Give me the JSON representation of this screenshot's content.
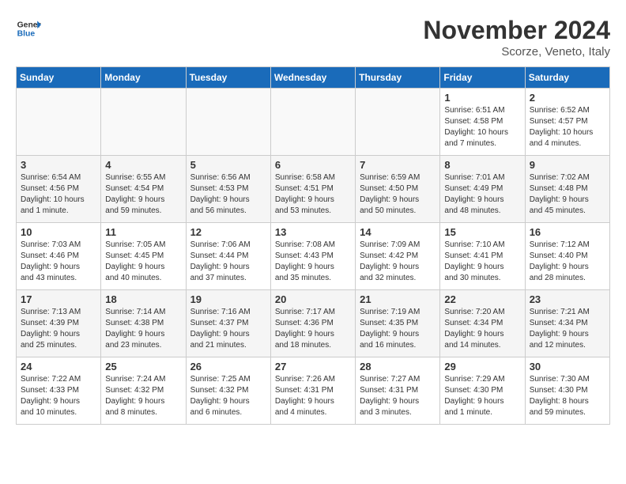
{
  "logo": {
    "line1": "General",
    "line2": "Blue"
  },
  "title": "November 2024",
  "location": "Scorze, Veneto, Italy",
  "weekdays": [
    "Sunday",
    "Monday",
    "Tuesday",
    "Wednesday",
    "Thursday",
    "Friday",
    "Saturday"
  ],
  "weeks": [
    [
      {
        "day": "",
        "info": ""
      },
      {
        "day": "",
        "info": ""
      },
      {
        "day": "",
        "info": ""
      },
      {
        "day": "",
        "info": ""
      },
      {
        "day": "",
        "info": ""
      },
      {
        "day": "1",
        "info": "Sunrise: 6:51 AM\nSunset: 4:58 PM\nDaylight: 10 hours\nand 7 minutes."
      },
      {
        "day": "2",
        "info": "Sunrise: 6:52 AM\nSunset: 4:57 PM\nDaylight: 10 hours\nand 4 minutes."
      }
    ],
    [
      {
        "day": "3",
        "info": "Sunrise: 6:54 AM\nSunset: 4:56 PM\nDaylight: 10 hours\nand 1 minute."
      },
      {
        "day": "4",
        "info": "Sunrise: 6:55 AM\nSunset: 4:54 PM\nDaylight: 9 hours\nand 59 minutes."
      },
      {
        "day": "5",
        "info": "Sunrise: 6:56 AM\nSunset: 4:53 PM\nDaylight: 9 hours\nand 56 minutes."
      },
      {
        "day": "6",
        "info": "Sunrise: 6:58 AM\nSunset: 4:51 PM\nDaylight: 9 hours\nand 53 minutes."
      },
      {
        "day": "7",
        "info": "Sunrise: 6:59 AM\nSunset: 4:50 PM\nDaylight: 9 hours\nand 50 minutes."
      },
      {
        "day": "8",
        "info": "Sunrise: 7:01 AM\nSunset: 4:49 PM\nDaylight: 9 hours\nand 48 minutes."
      },
      {
        "day": "9",
        "info": "Sunrise: 7:02 AM\nSunset: 4:48 PM\nDaylight: 9 hours\nand 45 minutes."
      }
    ],
    [
      {
        "day": "10",
        "info": "Sunrise: 7:03 AM\nSunset: 4:46 PM\nDaylight: 9 hours\nand 43 minutes."
      },
      {
        "day": "11",
        "info": "Sunrise: 7:05 AM\nSunset: 4:45 PM\nDaylight: 9 hours\nand 40 minutes."
      },
      {
        "day": "12",
        "info": "Sunrise: 7:06 AM\nSunset: 4:44 PM\nDaylight: 9 hours\nand 37 minutes."
      },
      {
        "day": "13",
        "info": "Sunrise: 7:08 AM\nSunset: 4:43 PM\nDaylight: 9 hours\nand 35 minutes."
      },
      {
        "day": "14",
        "info": "Sunrise: 7:09 AM\nSunset: 4:42 PM\nDaylight: 9 hours\nand 32 minutes."
      },
      {
        "day": "15",
        "info": "Sunrise: 7:10 AM\nSunset: 4:41 PM\nDaylight: 9 hours\nand 30 minutes."
      },
      {
        "day": "16",
        "info": "Sunrise: 7:12 AM\nSunset: 4:40 PM\nDaylight: 9 hours\nand 28 minutes."
      }
    ],
    [
      {
        "day": "17",
        "info": "Sunrise: 7:13 AM\nSunset: 4:39 PM\nDaylight: 9 hours\nand 25 minutes."
      },
      {
        "day": "18",
        "info": "Sunrise: 7:14 AM\nSunset: 4:38 PM\nDaylight: 9 hours\nand 23 minutes."
      },
      {
        "day": "19",
        "info": "Sunrise: 7:16 AM\nSunset: 4:37 PM\nDaylight: 9 hours\nand 21 minutes."
      },
      {
        "day": "20",
        "info": "Sunrise: 7:17 AM\nSunset: 4:36 PM\nDaylight: 9 hours\nand 18 minutes."
      },
      {
        "day": "21",
        "info": "Sunrise: 7:19 AM\nSunset: 4:35 PM\nDaylight: 9 hours\nand 16 minutes."
      },
      {
        "day": "22",
        "info": "Sunrise: 7:20 AM\nSunset: 4:34 PM\nDaylight: 9 hours\nand 14 minutes."
      },
      {
        "day": "23",
        "info": "Sunrise: 7:21 AM\nSunset: 4:34 PM\nDaylight: 9 hours\nand 12 minutes."
      }
    ],
    [
      {
        "day": "24",
        "info": "Sunrise: 7:22 AM\nSunset: 4:33 PM\nDaylight: 9 hours\nand 10 minutes."
      },
      {
        "day": "25",
        "info": "Sunrise: 7:24 AM\nSunset: 4:32 PM\nDaylight: 9 hours\nand 8 minutes."
      },
      {
        "day": "26",
        "info": "Sunrise: 7:25 AM\nSunset: 4:32 PM\nDaylight: 9 hours\nand 6 minutes."
      },
      {
        "day": "27",
        "info": "Sunrise: 7:26 AM\nSunset: 4:31 PM\nDaylight: 9 hours\nand 4 minutes."
      },
      {
        "day": "28",
        "info": "Sunrise: 7:27 AM\nSunset: 4:31 PM\nDaylight: 9 hours\nand 3 minutes."
      },
      {
        "day": "29",
        "info": "Sunrise: 7:29 AM\nSunset: 4:30 PM\nDaylight: 9 hours\nand 1 minute."
      },
      {
        "day": "30",
        "info": "Sunrise: 7:30 AM\nSunset: 4:30 PM\nDaylight: 8 hours\nand 59 minutes."
      }
    ]
  ]
}
